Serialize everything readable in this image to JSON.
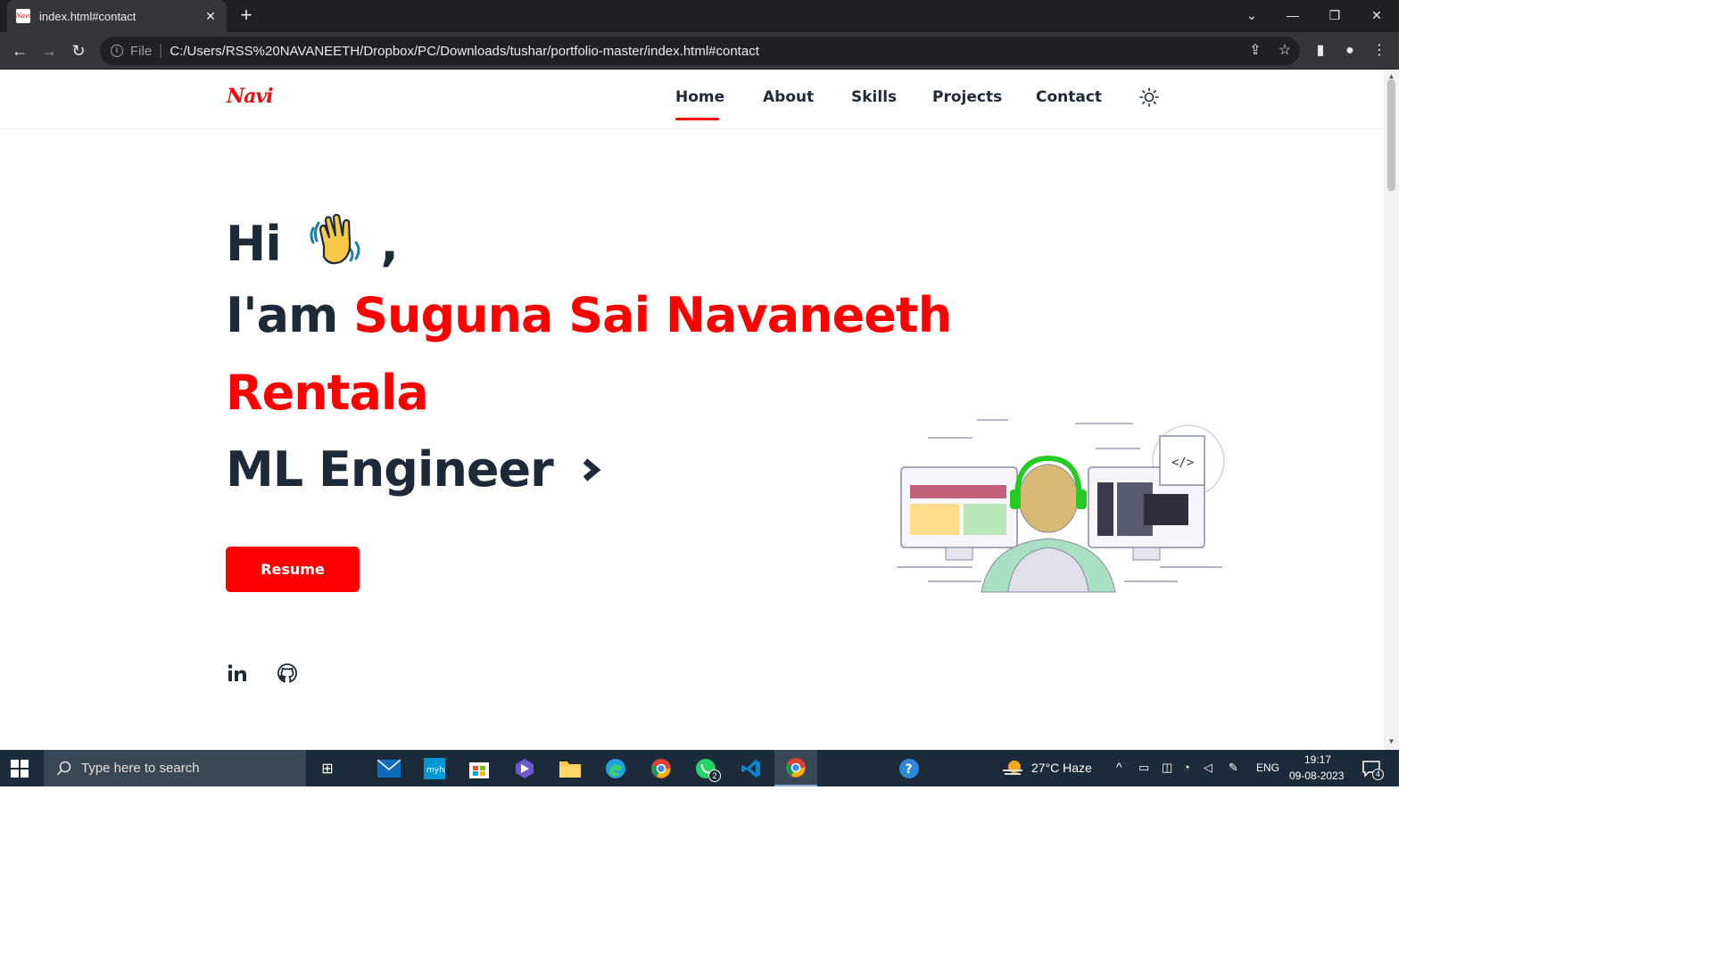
{
  "browser": {
    "tab_title": "index.html#contact",
    "tab_favicon": "Navi",
    "omnibox_scheme": "File",
    "omnibox_url": "C:/Users/RSS%20NAVANEETH/Dropbox/PC/Downloads/tushar/portfolio-master/index.html#contact"
  },
  "site": {
    "logo": "Navi",
    "nav": [
      "Home",
      "About",
      "Skills",
      "Projects",
      "Contact"
    ],
    "active_nav": "Home",
    "accent_color": "#ff0000",
    "text_color": "#1e2a38"
  },
  "hero": {
    "greeting": "Hi",
    "greeting_suffix": ",",
    "intro": "I'am",
    "name_line1": "Suguna Sai Navaneeth",
    "name_line2": "Rentala",
    "role": "ML Engineer",
    "role_icon": "chevron-right-icon",
    "resume_label": "Resume"
  },
  "taskbar": {
    "search_placeholder": "Type here to search",
    "weather": "27°C  Haze",
    "language": "ENG",
    "time": "19:17",
    "date": "09-08-2023",
    "whatsapp_badge": "2",
    "notification_count": "4"
  }
}
